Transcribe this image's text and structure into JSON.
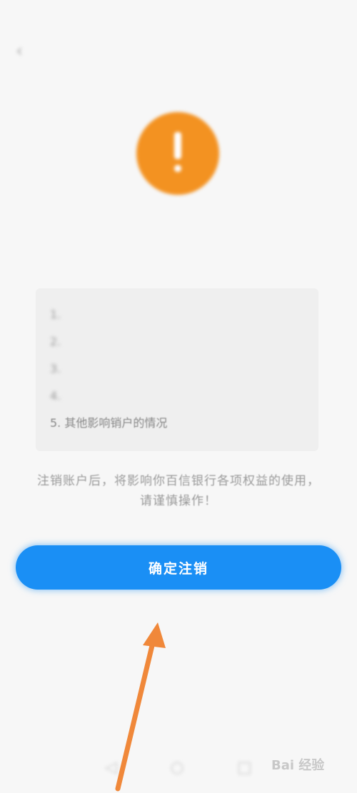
{
  "status_bar": {
    "left": "",
    "right": ""
  },
  "header": {
    "title": "",
    "back_icon": "chevron-left-icon"
  },
  "heading": "",
  "intro_text": "",
  "conditions": [
    {
      "num": "1.",
      "text": ""
    },
    {
      "num": "2.",
      "text": ""
    },
    {
      "num": "3.",
      "text": ""
    },
    {
      "num": "4.",
      "text": ""
    },
    {
      "num": "5.",
      "text": "其他影响销户的情况"
    }
  ],
  "notice": "注销账户后，将影响你百信银行各项权益的使用，请谨慎操作！",
  "confirm_button": "确定注销",
  "colors": {
    "warning": "#f39221",
    "primary": "#1a8ff5",
    "arrow": "#f0883a"
  },
  "watermark": "Bai 经验"
}
